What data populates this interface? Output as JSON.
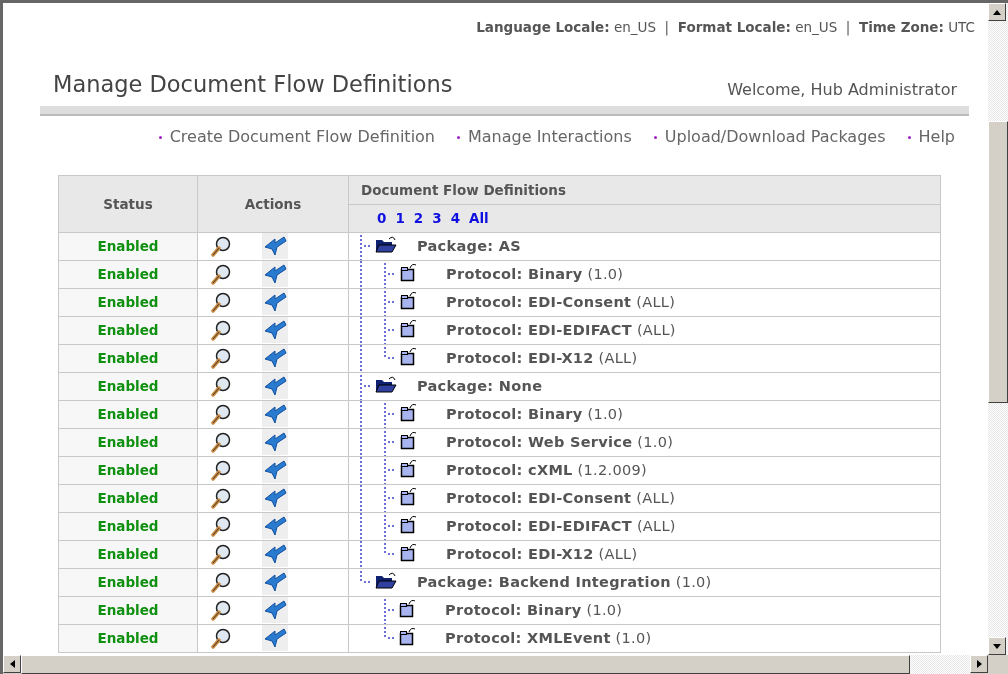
{
  "locale_bar": "**Language Locale:** en_US  |  **Format Locale:** en_US  |  **Time Zone:** UTC",
  "title": "Manage Document Flow Definitions",
  "welcome": "Welcome, Hub Administrator",
  "nav_links": [
    "Create Document Flow Definition",
    "Manage Interactions",
    "Upload/Download Packages",
    "Help"
  ],
  "table": {
    "columns": [
      "Status",
      "Actions",
      "Document Flow Definitions"
    ],
    "pager": [
      "0",
      "1",
      "2",
      "3",
      "4",
      "All"
    ],
    "packages": [
      {
        "status": "Enabled",
        "text": "**Package: AS**",
        "expanded": true,
        "children": [
          {
            "status": "Enabled",
            "text": "**Protocol: Binary** (1.0)"
          },
          {
            "status": "Enabled",
            "text": "**Protocol: EDI-Consent** (ALL)"
          },
          {
            "status": "Enabled",
            "text": "**Protocol: EDI-EDIFACT** (ALL)"
          },
          {
            "status": "Enabled",
            "text": "**Protocol: EDI-X12** (ALL)"
          }
        ]
      },
      {
        "status": "Enabled",
        "text": "**Package: None**",
        "expanded": true,
        "children": [
          {
            "status": "Enabled",
            "text": "**Protocol: Binary** (1.0)"
          },
          {
            "status": "Enabled",
            "text": "**Protocol: Web Service** (1.0)"
          },
          {
            "status": "Enabled",
            "text": "**Protocol: cXML** (1.2.009)"
          },
          {
            "status": "Enabled",
            "text": "**Protocol: EDI-Consent** (ALL)"
          },
          {
            "status": "Enabled",
            "text": "**Protocol: EDI-EDIFACT** (ALL)"
          },
          {
            "status": "Enabled",
            "text": "**Protocol: EDI-X12** (ALL)"
          }
        ]
      },
      {
        "status": "Enabled",
        "text": "**Package: Backend Integration** (1.0)",
        "expanded": true,
        "children": [
          {
            "status": "Enabled",
            "text": "**Protocol: Binary** (1.0)"
          },
          {
            "status": "Enabled",
            "text": "**Protocol: XMLEvent** (1.0)"
          }
        ]
      }
    ]
  }
}
